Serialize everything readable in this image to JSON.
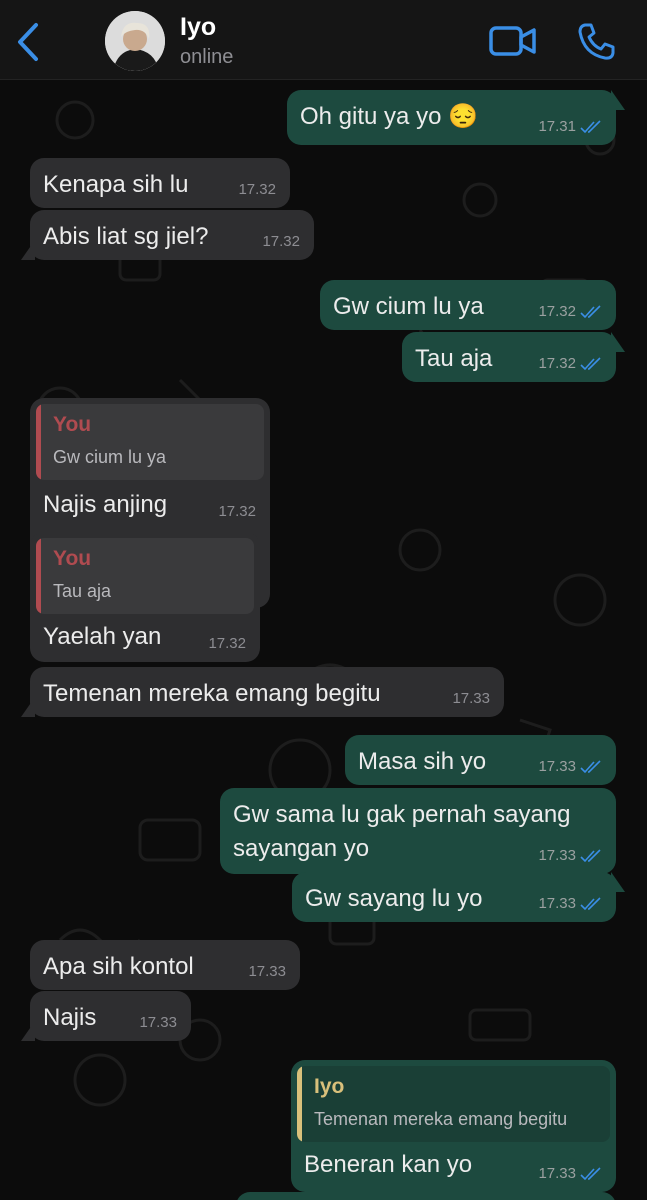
{
  "contact": {
    "name": "Iyo",
    "status": "online"
  },
  "colors": {
    "accent": "#3a8ee6",
    "outgoing_bubble": "#1d4a3f",
    "incoming_bubble": "#2e2e30",
    "quote_you": "#b04b50",
    "quote_iyo": "#d9c07b"
  },
  "icons": {
    "back": "chevron-left-icon",
    "video": "video-camera-icon",
    "call": "phone-icon",
    "read": "double-check-icon"
  },
  "messages": [
    {
      "text": "Oh gitu ya yo 😔",
      "time": "17.31"
    },
    {
      "text": "Kenapa sih lu",
      "time": "17.32"
    },
    {
      "text": "Abis liat sg jiel?",
      "time": "17.32"
    },
    {
      "text": "Gw cium lu ya",
      "time": "17.32"
    },
    {
      "text": "Tau aja",
      "time": "17.32"
    },
    {
      "quote_name": "You",
      "quote_text": "Gw cium lu ya",
      "text": "Najis anjing",
      "time": "17.32"
    },
    {
      "quote_name": "You",
      "quote_text": "Tau aja",
      "text": "Yaelah yan",
      "time": "17.32"
    },
    {
      "text": "Temenan mereka emang begitu",
      "time": "17.33"
    },
    {
      "text": "Masa sih yo",
      "time": "17.33"
    },
    {
      "text_line1": "Gw sama lu gak pernah sayang",
      "text_line2": "sayangan yo",
      "time": "17.33"
    },
    {
      "text": "Gw sayang lu yo",
      "time": "17.33"
    },
    {
      "text": "Apa sih kontol",
      "time": "17.33"
    },
    {
      "text": "Najis",
      "time": "17.33"
    },
    {
      "quote_name": "Iyo",
      "quote_text": "Temenan mereka emang begitu",
      "text": "Beneran kan yo",
      "time": "17.33"
    }
  ]
}
